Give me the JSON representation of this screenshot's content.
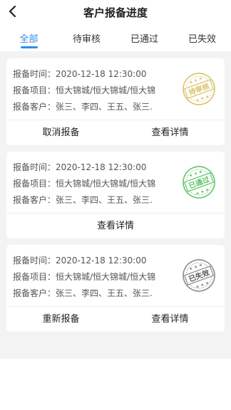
{
  "header": {
    "title": "客户报备进度"
  },
  "tabs": [
    {
      "label": "全部",
      "active": true
    },
    {
      "label": "待审核",
      "active": false
    },
    {
      "label": "已通过",
      "active": false
    },
    {
      "label": "已失效",
      "active": false
    }
  ],
  "labels": {
    "time": "报备时间：",
    "project": "报备项目：",
    "customer": "报备客户："
  },
  "cards": [
    {
      "time": "2020-12-18 12:30:00",
      "project": "恒大锦城/恒大锦城/恒大锦",
      "customer": "张三、李四、王五、张三.",
      "stamp": {
        "text": "待审核",
        "color": "#d9c26a",
        "icon": "pending-stamp-icon"
      },
      "actions": [
        "取消报备",
        "查看详情"
      ]
    },
    {
      "time": "2020-12-18 12:30:00",
      "project": "恒大锦城/恒大锦城/恒大锦",
      "customer": "张三、李四、王五、张三.",
      "stamp": {
        "text": "已通过",
        "color": "#5fc468",
        "icon": "approved-stamp-icon"
      },
      "actions": [
        "查看详情"
      ]
    },
    {
      "time": "2020-12-18 12:30:00",
      "project": "恒大锦城/恒大锦城/恒大锦",
      "customer": "张三、李四、王五、张三.",
      "stamp": {
        "text": "已失效",
        "color": "#8a8a8a",
        "icon": "expired-stamp-icon"
      },
      "actions": [
        "重新报备",
        "查看详情"
      ]
    }
  ],
  "colors": {
    "accent": "#2f8ceb",
    "background": "#f3f3f3"
  }
}
